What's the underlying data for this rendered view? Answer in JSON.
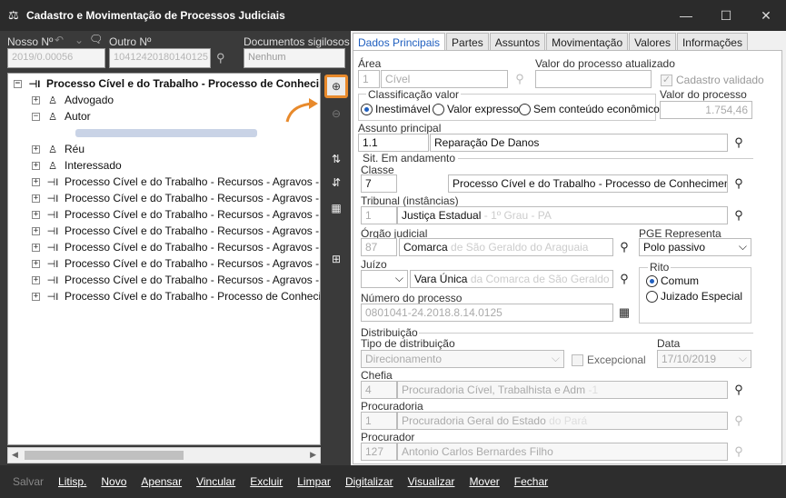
{
  "window": {
    "title": "Cadastro e Movimentação de Processos Judiciais",
    "minimize_icon": "minimize-icon",
    "maximize_icon": "maximize-icon",
    "close_icon": "close-icon"
  },
  "header": {
    "nosso_label": "Nosso Nº",
    "outro_label": "Outro Nº",
    "docs_label": "Documentos sigilosos",
    "docs_value": "Nenhum",
    "nosso_value": "2019/0.00056",
    "outro_value": "10412420180140125"
  },
  "tree": {
    "root": "Processo Cível e do Trabalho - Processo de Conhecimento",
    "advogado": "Advogado",
    "autor": "Autor",
    "reu": "Réu",
    "interessado": "Interessado",
    "recursos": [
      "Processo Cível e do Trabalho - Recursos - Agravos - Agravo",
      "Processo Cível e do Trabalho - Recursos - Agravos - Agravo",
      "Processo Cível e do Trabalho - Recursos - Agravos - Agravo",
      "Processo Cível e do Trabalho - Recursos - Agravos - Agravo",
      "Processo Cível e do Trabalho - Recursos - Agravos - Agravo",
      "Processo Cível e do Trabalho - Recursos - Agravos - Agravo",
      "Processo Cível e do Trabalho - Recursos - Agravos - Agravo"
    ],
    "last": "Processo Cível e do Trabalho - Processo de Conhecimento"
  },
  "tabs": [
    "Dados Principais",
    "Partes",
    "Assuntos",
    "Movimentação",
    "Valores",
    "Informações"
  ],
  "form": {
    "area_label": "Área",
    "area_code": "1",
    "area_value": "Cível",
    "valor_atualizado_label": "Valor do processo atualizado",
    "cadastro_validado": "Cadastro validado",
    "classificacao_label": "Classificação valor",
    "radio_inestimavel": "Inestimável",
    "radio_expresso": "Valor expresso",
    "radio_sem": "Sem conteúdo econômico",
    "valor_processo_label": "Valor do processo",
    "valor_processo_value": "1.754,46",
    "assunto_label": "Assunto principal",
    "assunto_code": "1.1",
    "assunto_value": "Reparação De Danos",
    "sit_label": "Sit. Em andamento",
    "classe_label": "Classe",
    "classe_code": "7",
    "classe_value": "Processo Cível e do Trabalho - Processo de Conhecimento - Proce",
    "tribunal_label": "Tribunal (instâncias)",
    "tribunal_code": "1",
    "tribunal_value": "Justiça Estadual",
    "tribunal_hidden": "- 1º Grau - PA",
    "orgao_label": "Órgão judicial",
    "orgao_code": "87",
    "orgao_value": "Comarca",
    "orgao_hidden": "de São Geraldo do Araguaia",
    "pge_label": "PGE Representa",
    "pge_value": "Polo passivo",
    "juizo_label": "Juízo",
    "juizo_value": "Vara Única",
    "juizo_hidden": "da Comarca de São Geraldo do",
    "rito_label": "Rito",
    "rito_comum": "Comum",
    "rito_juizado": "Juizado Especial",
    "numero_label": "Número do processo",
    "numero_value": "0801041-24.2018.8.14.0125",
    "distribuicao_label": "Distribuição",
    "tipo_dist_label": "Tipo de distribuição",
    "tipo_dist_value": "Direcionamento",
    "excepcional": "Excepcional",
    "data_label": "Data",
    "data_value": "17/10/2019",
    "chefia_label": "Chefia",
    "chefia_code": "4",
    "chefia_value": "Procuradoria Cível, Trabalhista e Adm",
    "chefia_hidden": "-1",
    "procuradoria_label": "Procuradoria",
    "procuradoria_code": "1",
    "procuradoria_value": "Procuradoria Geral do Estado",
    "procuradoria_hidden": "do Pará",
    "procurador_label": "Procurador",
    "procurador_code": "127",
    "procurador_value": "Antonio Carlos Bernardes Filho"
  },
  "bottom": {
    "salvar": "Salvar",
    "litisp": "Litisp.",
    "novo": "Novo",
    "apensar": "Apensar",
    "vincular": "Vincular",
    "excluir": "Excluir",
    "limpar": "Limpar",
    "digitalizar": "Digitalizar",
    "visualizar": "Visualizar",
    "mover": "Mover",
    "fechar": "Fechar"
  },
  "colors": {
    "accent": "#1f5fbf",
    "highlight": "#e88a2c"
  }
}
